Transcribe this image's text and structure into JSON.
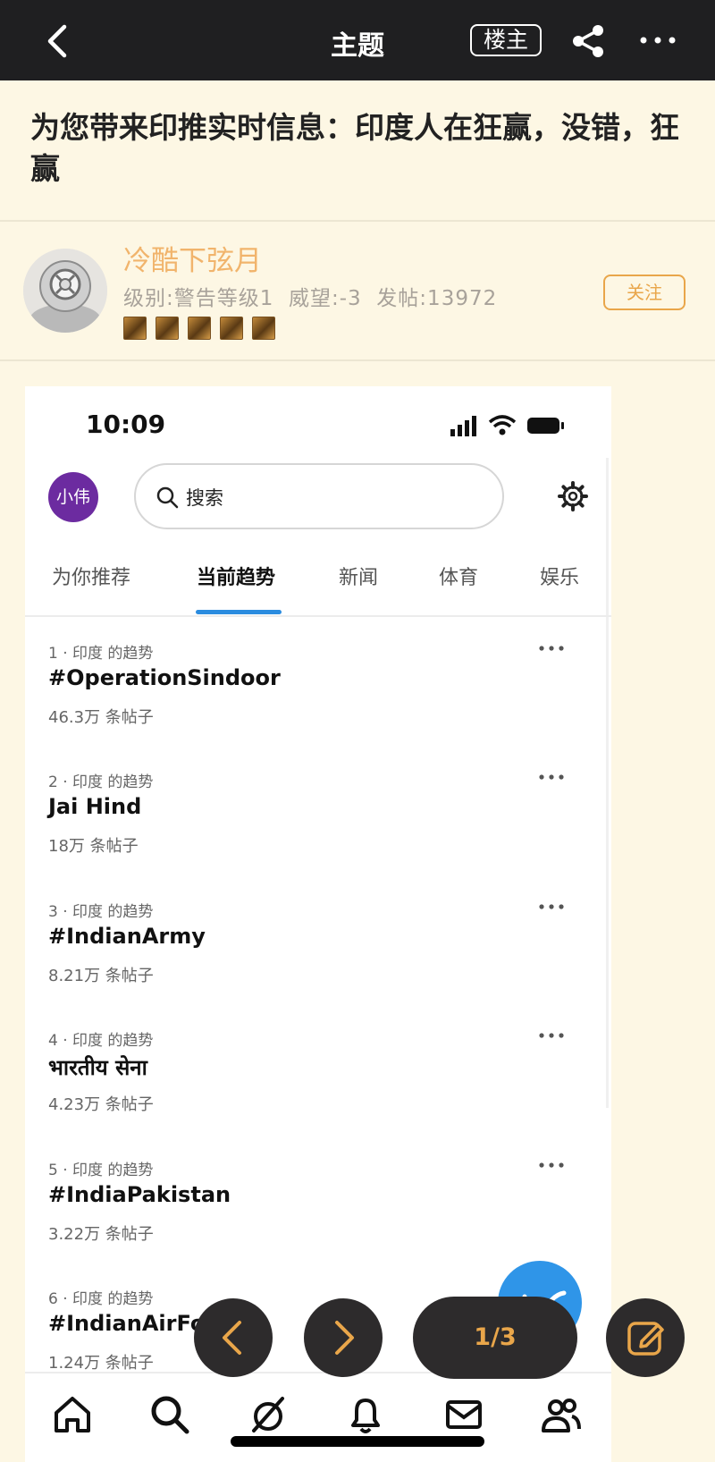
{
  "topbar": {
    "title": "主题",
    "op_label": "楼主",
    "icons": [
      "back-arrow-icon",
      "share-icon",
      "more-icon"
    ]
  },
  "post": {
    "title": "为您带来印推实时信息：印度人在狂赢，没错，狂赢",
    "author": {
      "name": "冷酷下弦月",
      "stats": "级别:警告等级1  威望:-3  发帖:13972",
      "follow_label": "关注"
    }
  },
  "screenshot": {
    "time": "10:09",
    "avatar_text": "小伟",
    "search_placeholder": "搜索",
    "tabs": [
      "为你推荐",
      "当前趋势",
      "新闻",
      "体育",
      "娱乐"
    ],
    "active_tab": "当前趋势",
    "trends": [
      {
        "meta": "1 · 印度 的趋势",
        "tag": "#OperationSindoor",
        "count": "46.3万 条帖子"
      },
      {
        "meta": "2 · 印度 的趋势",
        "tag": "Jai Hind",
        "count": "18万 条帖子"
      },
      {
        "meta": "3 · 印度 的趋势",
        "tag": "#IndianArmy",
        "count": "8.21万 条帖子"
      },
      {
        "meta": "4 · 印度 的趋势",
        "tag": "भारतीय सेना",
        "count": "4.23万 条帖子"
      },
      {
        "meta": "5 · 印度 的趋势",
        "tag": "#IndiaPakistan",
        "count": "3.22万 条帖子"
      },
      {
        "meta": "6 · 印度 的趋势",
        "tag": "#IndianAirForce",
        "count": "1.24万 条帖子"
      }
    ],
    "bottom_nav": [
      "home-icon",
      "search-icon",
      "grok-icon",
      "bell-icon",
      "mail-icon",
      "people-icon"
    ]
  },
  "overlay": {
    "page_indicator": "1/3"
  },
  "colors": {
    "accent": "#e9a64a",
    "author_name": "#f1b46c",
    "topbar_bg": "#1f1f21",
    "page_bg": "#fdf7e4",
    "tab_underline": "#2b8cdf"
  }
}
